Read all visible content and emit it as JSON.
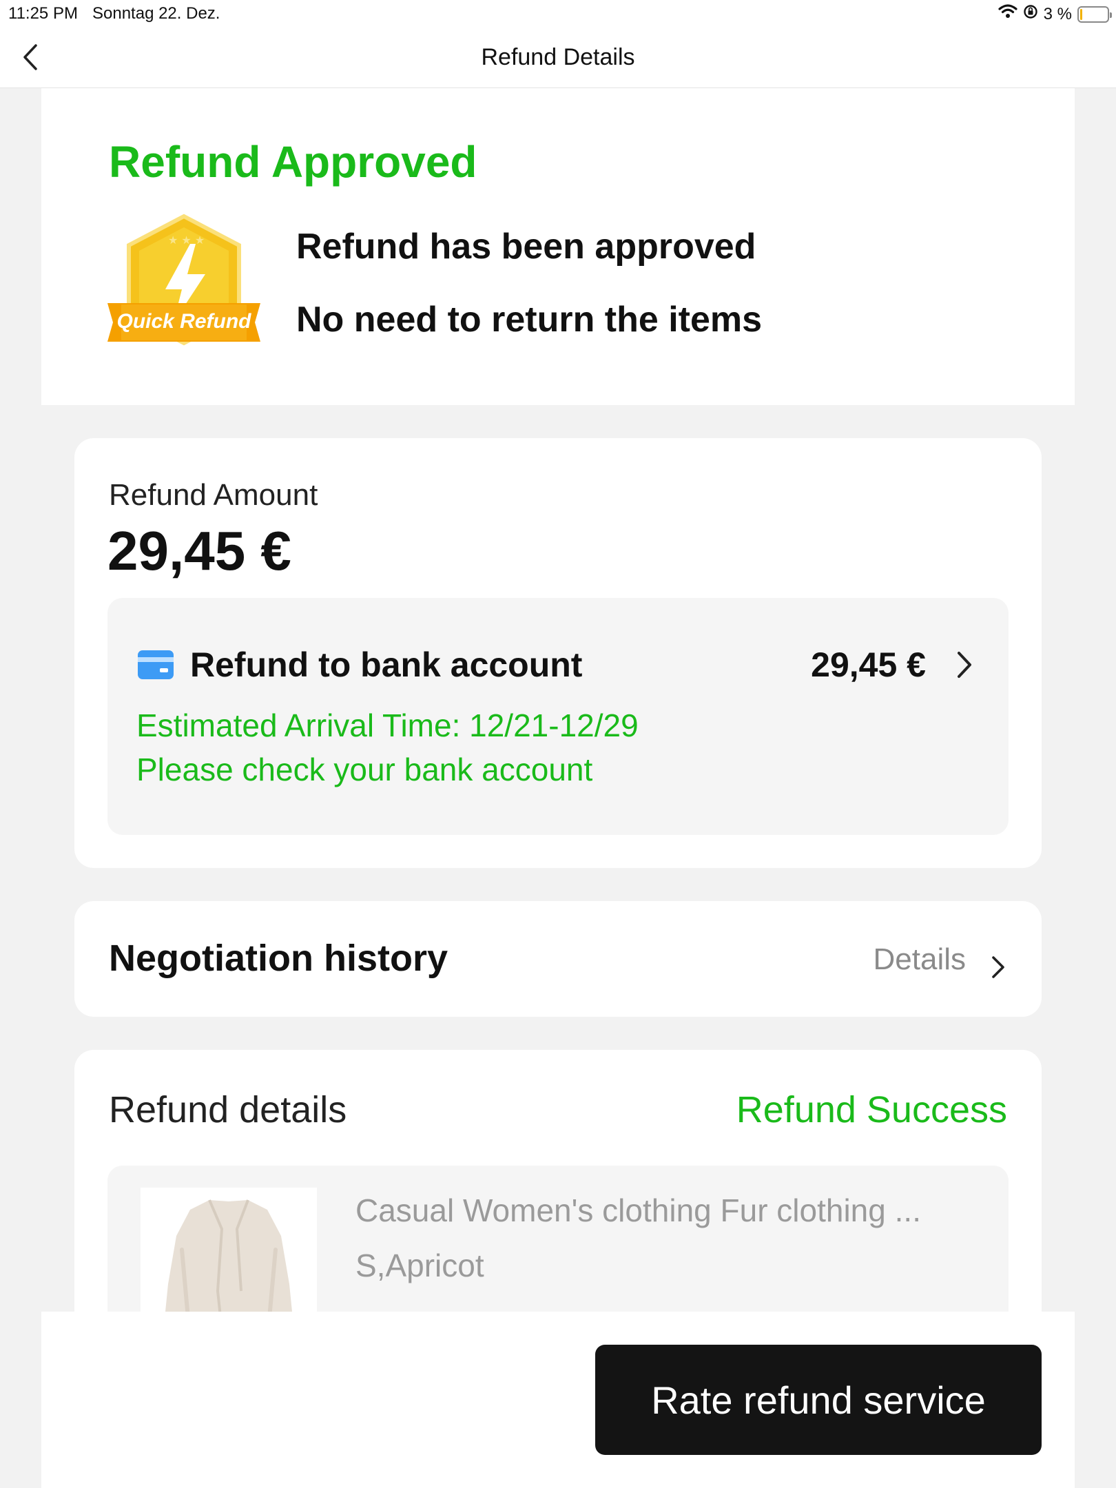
{
  "status_bar": {
    "time": "11:25 PM",
    "date": "Sonntag 22. Dez.",
    "battery": "3 %"
  },
  "nav": {
    "title": "Refund Details"
  },
  "approval": {
    "title": "Refund Approved",
    "badge_text": "Quick Refund",
    "line1": "Refund has been approved",
    "line2": "No need to return the items"
  },
  "amount": {
    "label": "Refund Amount",
    "value": "29,45 €",
    "method": {
      "label": "Refund to bank account",
      "amount": "29,45 €",
      "eta": "Estimated Arrival Time: 12/21-12/29",
      "note": "Please check your bank account"
    }
  },
  "negotiation": {
    "title": "Negotiation history",
    "link": "Details"
  },
  "refund_details": {
    "title": "Refund details",
    "status": "Refund Success",
    "item": {
      "name": "Casual Women's clothing Fur clothing ...",
      "variant": "S,Apricot"
    }
  },
  "footer": {
    "rate_button": "Rate refund service"
  },
  "colors": {
    "success_green": "#1aba1a",
    "button_dark": "#141414",
    "badge_yellow": "#f5c21b",
    "badge_orange": "#f5a000",
    "card_blue": "#3d9bf5"
  }
}
